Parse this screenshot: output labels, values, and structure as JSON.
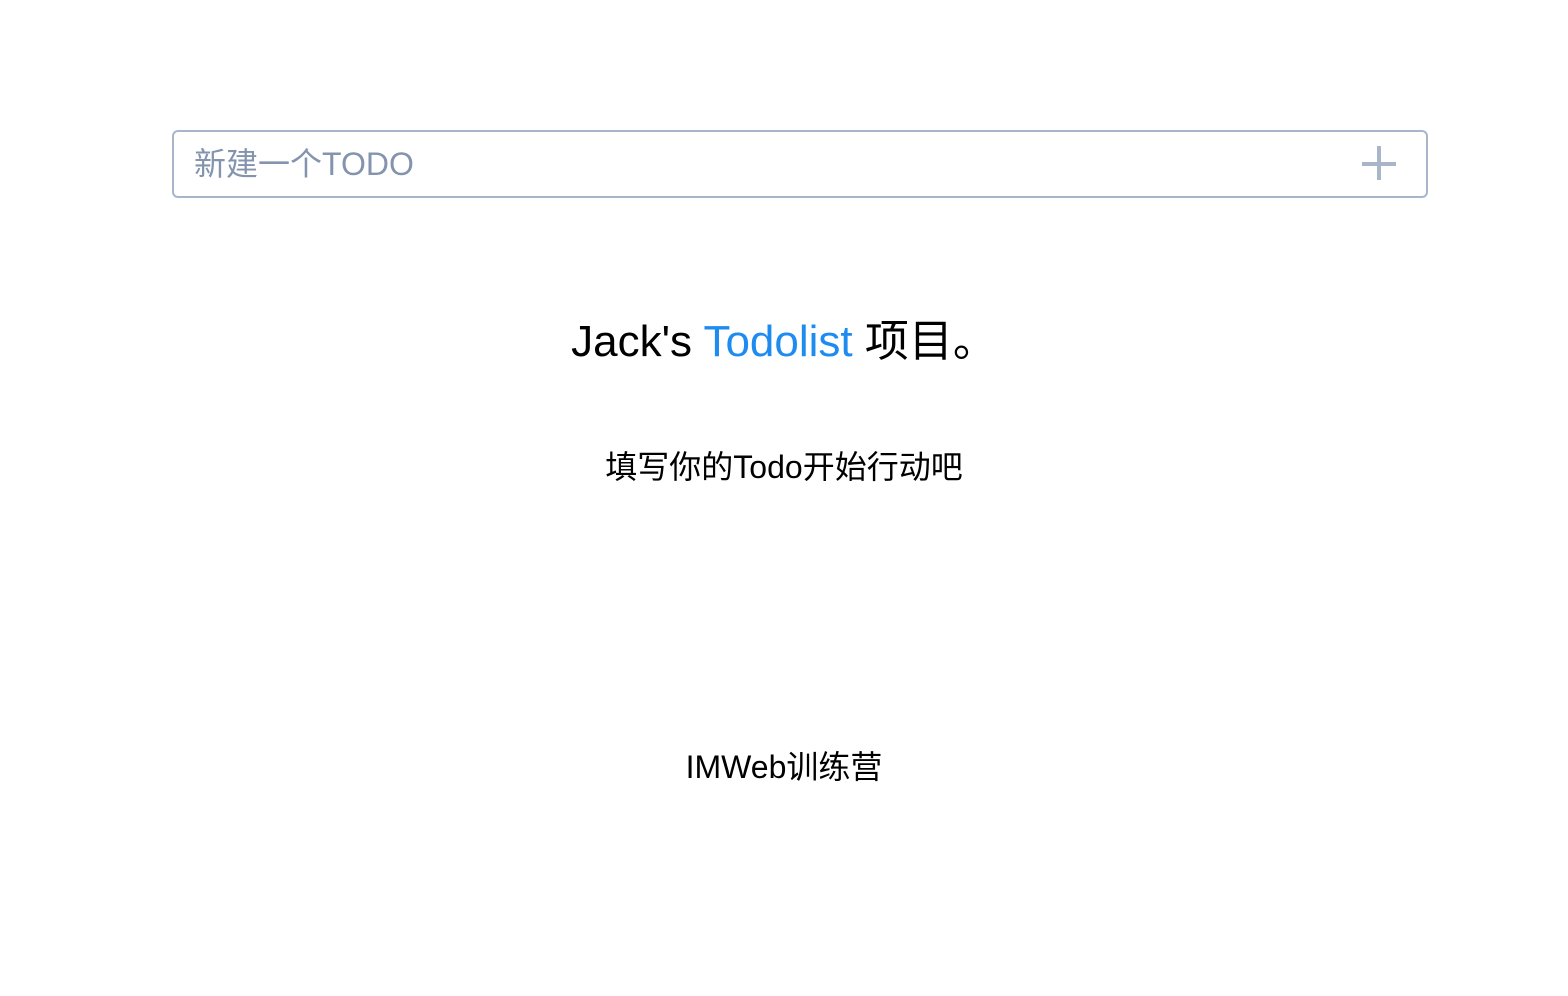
{
  "input": {
    "placeholder": "新建一个TODO",
    "value": ""
  },
  "add_button": {
    "icon": "plus-icon"
  },
  "title": {
    "prefix": "Jack's ",
    "accent": "Todolist",
    "suffix": " 项目。"
  },
  "subtitle": "填写你的Todo开始行动吧",
  "footer": "IMWeb训练营",
  "colors": {
    "accent": "#1e8bf0",
    "border": "#a9b6ca",
    "placeholder": "#8494ae"
  }
}
